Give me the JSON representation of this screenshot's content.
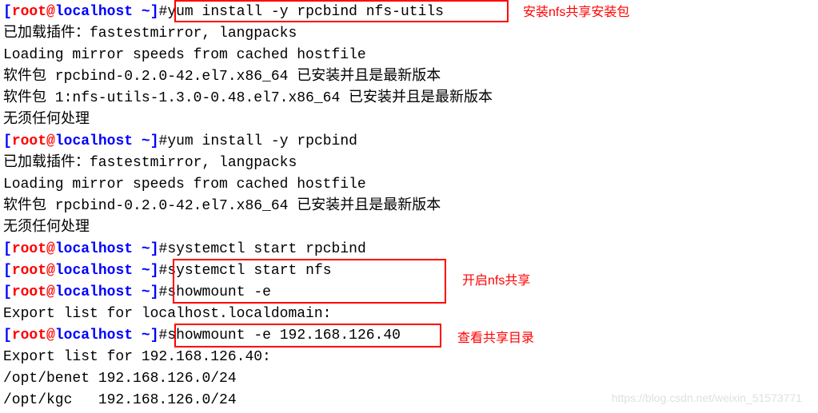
{
  "prompt": {
    "open": "[",
    "user": "root",
    "at": "@",
    "host": "localhost",
    "space": " ",
    "path": "~",
    "close": "]",
    "hash": "#"
  },
  "cmds": {
    "c1": "yum install -y rpcbind nfs-utils",
    "c2": "yum install -y rpcbind",
    "c3": "systemctl start rpcbind",
    "c4": "systemctl start nfs",
    "c5": "showmount -e",
    "c6": "showmount -e 192.168.126.40"
  },
  "out": {
    "o1": "已加载插件：fastestmirror, langpacks",
    "o2": "Loading mirror speeds from cached hostfile",
    "o3": "软件包 rpcbind-0.2.0-42.el7.x86_64 已安装并且是最新版本",
    "o4": "软件包 1:nfs-utils-1.3.0-0.48.el7.x86_64 已安装并且是最新版本",
    "o5": "无须任何处理",
    "o6": "已加载插件：fastestmirror, langpacks",
    "o7": "Loading mirror speeds from cached hostfile",
    "o8": "软件包 rpcbind-0.2.0-42.el7.x86_64 已安装并且是最新版本",
    "o9": "无须任何处理",
    "o10": "Export list for localhost.localdomain:",
    "o11": "Export list for 192.168.126.40:",
    "o12": "/opt/benet 192.168.126.0/24",
    "o13": "/opt/kgc   192.168.126.0/24"
  },
  "annotations": {
    "a1": "安装nfs共享安装包",
    "a2": "开启nfs共享",
    "a3": "查看共享目录"
  },
  "watermark": "https://blog.csdn.net/weixin_51573771"
}
